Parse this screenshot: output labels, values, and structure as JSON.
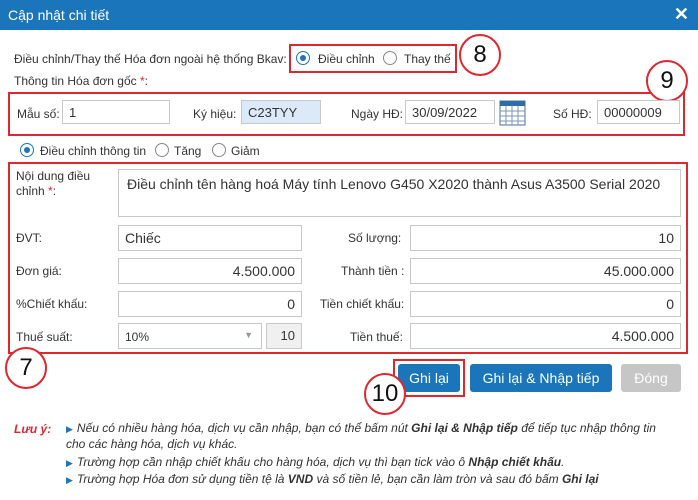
{
  "dialog": {
    "title": "Cập nhật chi tiết",
    "close_icon": "✕"
  },
  "adjust_type": {
    "label": "Điều chỉnh/Thay thế Hóa đơn ngoài hệ thống Bkav:",
    "options": [
      "Điều chỉnh",
      "Thay thế"
    ],
    "selected": "Điều chỉnh"
  },
  "original_invoice": {
    "section_label": "Thông tin Hóa đơn gốc",
    "required_mark": "*",
    "colon": ":",
    "template_label": "Mẫu số:",
    "template_value": "1",
    "symbol_label": "Ký hiệu:",
    "symbol_value": "C23TYY",
    "date_label": "Ngày HĐ:",
    "date_value": "30/09/2022",
    "number_label": "Số HĐ:",
    "number_value": "00000009"
  },
  "adjust_mode": {
    "options": [
      "Điều chỉnh thông tin",
      "Tăng",
      "Giảm"
    ],
    "selected": "Điều chỉnh thông tin"
  },
  "detail": {
    "content_label_1": "Nội dung điều",
    "content_label_2": "chỉnh",
    "content_required": " *",
    "content_colon": ":",
    "content_value": "Điều chỉnh tên hàng hoá Máy tính Lenovo G450 X2020 thành Asus A3500 Serial 2020",
    "unit_label": "ĐVT:",
    "unit_value": "Chiếc",
    "qty_label": "Số lượng:",
    "qty_value": "10",
    "price_label": "Đơn giá:",
    "price_value": "4.500.000",
    "amount_label": "Thành tiền :",
    "amount_value": "45.000.000",
    "discount_pct_label": "%Chiết khấu:",
    "discount_pct_value": "0",
    "discount_amt_label": "Tiền chiết khấu:",
    "discount_amt_value": "0",
    "tax_rate_label": "Thuế suất:",
    "tax_rate_value": "10%",
    "tax_rate_number": "10",
    "tax_amt_label": "Tiền thuế:",
    "tax_amt_value": "4.500.000"
  },
  "buttons": {
    "save": "Ghi lại",
    "save_continue": "Ghi lại & Nhập tiếp",
    "close": "Đóng"
  },
  "callouts": {
    "c7": "7",
    "c8": "8",
    "c9": "9",
    "c10": "10"
  },
  "notes": {
    "label": "Lưu ý:",
    "n1_a": "Nếu có nhiều hàng hóa, dịch vụ cần nhập, bạn có thể bấm nút ",
    "n1_b": "Ghi lại & Nhập tiếp",
    "n1_c": " để tiếp tục nhập thông tin",
    "n1_d": "cho các hàng hóa, dịch vụ khác.",
    "n2_a": "Trường hợp cần nhập chiết khấu cho hàng hóa, dịch vụ thì bạn tick vào ô ",
    "n2_b": "Nhập chiết khấu",
    "n2_c": ".",
    "n3_a": "Trường hợp Hóa đơn sử dụng tiền tệ là ",
    "n3_b": "VND",
    "n3_c": " và số tiền lẻ, bạn cần làm tròn và sau đó bấm ",
    "n3_d": "Ghi lại"
  },
  "colors": {
    "accent": "#1b75bb",
    "highlight": "#e0262e",
    "required": "#e0262e"
  }
}
